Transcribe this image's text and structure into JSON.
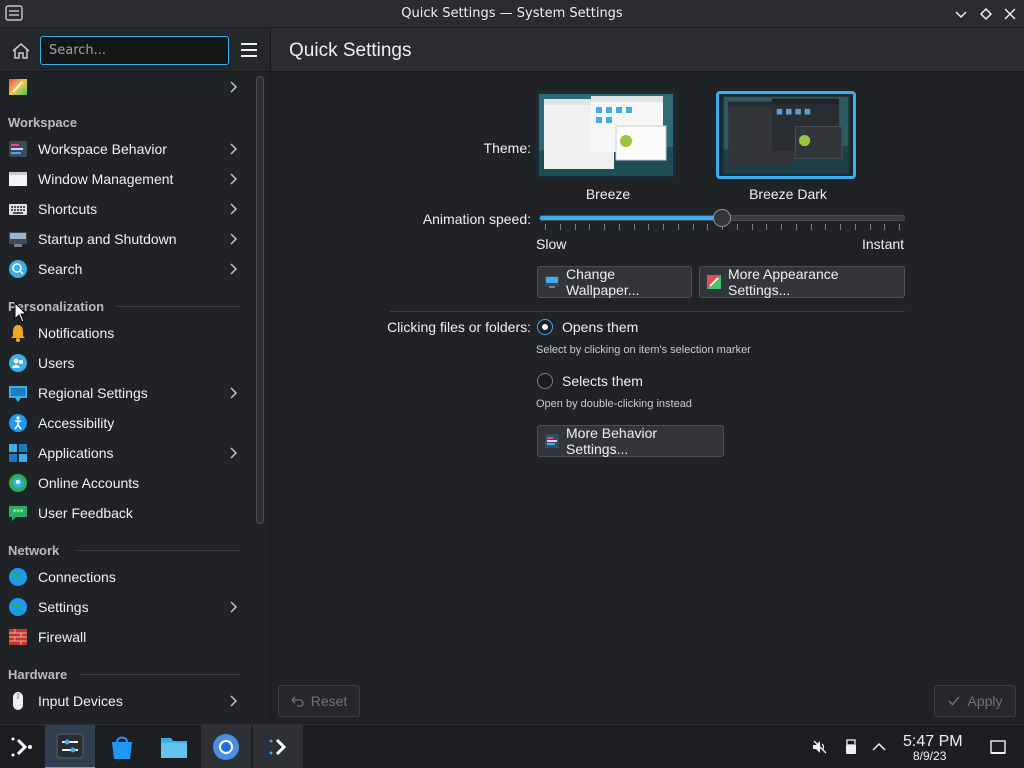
{
  "window": {
    "title": "Quick Settings — System Settings",
    "buttons": [
      "minimize",
      "maximize",
      "close"
    ]
  },
  "sidebar": {
    "search_placeholder": "Search...",
    "first_item_label": "",
    "sections": [
      {
        "title": "Workspace",
        "items": [
          {
            "label": "Workspace Behavior",
            "icon": "workspace-behavior-icon",
            "has_children": true
          },
          {
            "label": "Window Management",
            "icon": "window-management-icon",
            "has_children": true
          },
          {
            "label": "Shortcuts",
            "icon": "keyboard-icon",
            "has_children": true
          },
          {
            "label": "Startup and Shutdown",
            "icon": "startup-icon",
            "has_children": true
          },
          {
            "label": "Search",
            "icon": "search-icon",
            "has_children": true
          }
        ]
      },
      {
        "title": "Personalization",
        "items": [
          {
            "label": "Notifications",
            "icon": "bell-icon",
            "has_children": false
          },
          {
            "label": "Users",
            "icon": "users-icon",
            "has_children": false
          },
          {
            "label": "Regional Settings",
            "icon": "regional-icon",
            "has_children": true
          },
          {
            "label": "Accessibility",
            "icon": "accessibility-icon",
            "has_children": false
          },
          {
            "label": "Applications",
            "icon": "applications-icon",
            "has_children": true
          },
          {
            "label": "Online Accounts",
            "icon": "online-accounts-icon",
            "has_children": false
          },
          {
            "label": "User Feedback",
            "icon": "feedback-icon",
            "has_children": false
          }
        ]
      },
      {
        "title": "Network",
        "items": [
          {
            "label": "Connections",
            "icon": "globe-icon",
            "has_children": false
          },
          {
            "label": "Settings",
            "icon": "globe-settings-icon",
            "has_children": true
          },
          {
            "label": "Firewall",
            "icon": "firewall-icon",
            "has_children": false
          }
        ]
      },
      {
        "title": "Hardware",
        "items": [
          {
            "label": "Input Devices",
            "icon": "mouse-icon",
            "has_children": true
          }
        ]
      }
    ]
  },
  "main": {
    "title": "Quick Settings",
    "theme_label": "Theme:",
    "themes": [
      {
        "name": "Breeze",
        "selected": false
      },
      {
        "name": "Breeze Dark",
        "selected": true
      }
    ],
    "animation_label": "Animation speed:",
    "animation_min": "Slow",
    "animation_max": "Instant",
    "animation_value": 0.5,
    "change_wallpaper": "Change Wallpaper...",
    "more_appearance": "More Appearance Settings...",
    "clicking_label": "Clicking files or folders:",
    "option_open": "Opens them",
    "option_open_hint": "Select by clicking on item's selection marker",
    "option_select": "Selects them",
    "option_select_hint": "Open by double-clicking instead",
    "selected_option": "open",
    "more_behavior": "More Behavior Settings...",
    "reset": "Reset",
    "apply": "Apply"
  },
  "taskbar": {
    "time": "5:47 PM",
    "date": "8/9/23"
  },
  "colors": {
    "accent": "#3daee9",
    "background": "#202326",
    "header": "#292c30"
  }
}
